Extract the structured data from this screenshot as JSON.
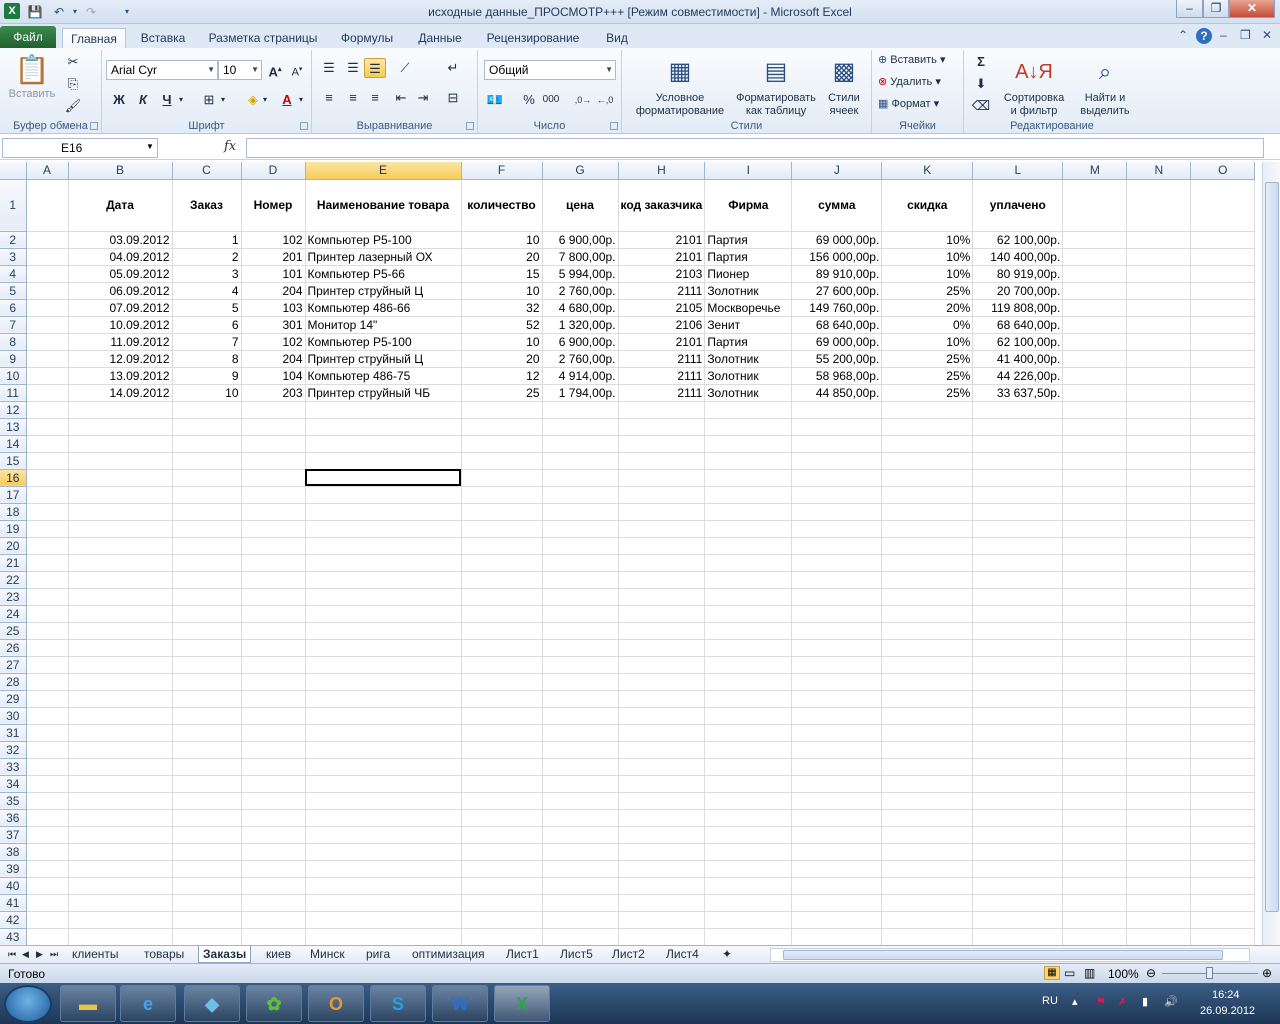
{
  "window": {
    "title": "исходные данные_ПРОСМОТР+++  [Режим совместимости]  -  Microsoft Excel"
  },
  "ribbon_tabs": [
    "Файл",
    "Главная",
    "Вставка",
    "Разметка страницы",
    "Формулы",
    "Данные",
    "Рецензирование",
    "Вид"
  ],
  "ribbon": {
    "clipboard": {
      "label": "Буфер обмена",
      "paste": "Вставить"
    },
    "font": {
      "label": "Шрифт",
      "name": "Arial Cyr",
      "size": "10",
      "bold": "Ж",
      "italic": "К",
      "underline": "Ч"
    },
    "alignment": {
      "label": "Выравнивание"
    },
    "number": {
      "label": "Число",
      "format": "Общий"
    },
    "styles": {
      "label": "Стили",
      "conditional": "Условное форматирование",
      "as_table": "Форматировать как таблицу",
      "cell_styles": "Стили ячеек"
    },
    "cells": {
      "label": "Ячейки",
      "insert": "Вставить",
      "delete": "Удалить",
      "format": "Формат"
    },
    "editing": {
      "label": "Редактирование",
      "sort": "Сортировка и фильтр",
      "find": "Найти и выделить"
    }
  },
  "formula_bar": {
    "name_box": "E16",
    "fx": "fx",
    "value": ""
  },
  "columns": [
    "A",
    "B",
    "C",
    "D",
    "E",
    "F",
    "G",
    "H",
    "I",
    "J",
    "K",
    "L",
    "M",
    "N",
    "O"
  ],
  "headers": [
    "Дата",
    "Заказ",
    "Номер",
    "Наименование товара",
    "количество",
    "цена",
    "код заказчика",
    "Фирма",
    "сумма",
    "скидка",
    "уплачено"
  ],
  "rows": [
    [
      "03.09.2012",
      "1",
      "102",
      "Компьютер Р5-100",
      "10",
      "6 900,00р.",
      "2101",
      "Партия",
      "69 000,00р.",
      "10%",
      "62 100,00р."
    ],
    [
      "04.09.2012",
      "2",
      "201",
      "Принтер лазерный ОХ",
      "20",
      "7 800,00р.",
      "2101",
      "Партия",
      "156 000,00р.",
      "10%",
      "140 400,00р."
    ],
    [
      "05.09.2012",
      "3",
      "101",
      "Компьютер Р5-66",
      "15",
      "5 994,00р.",
      "2103",
      "Пионер",
      "89 910,00р.",
      "10%",
      "80 919,00р."
    ],
    [
      "06.09.2012",
      "4",
      "204",
      "Принтер струйный Ц",
      "10",
      "2 760,00р.",
      "2111",
      "Золотник",
      "27 600,00р.",
      "25%",
      "20 700,00р."
    ],
    [
      "07.09.2012",
      "5",
      "103",
      "Компьютер 486-66",
      "32",
      "4 680,00р.",
      "2105",
      "Москворечье",
      "149 760,00р.",
      "20%",
      "119 808,00р."
    ],
    [
      "10.09.2012",
      "6",
      "301",
      "Монитор 14\"",
      "52",
      "1 320,00р.",
      "2106",
      "Зенит",
      "68 640,00р.",
      "0%",
      "68 640,00р."
    ],
    [
      "11.09.2012",
      "7",
      "102",
      "Компьютер Р5-100",
      "10",
      "6 900,00р.",
      "2101",
      "Партия",
      "69 000,00р.",
      "10%",
      "62 100,00р."
    ],
    [
      "12.09.2012",
      "8",
      "204",
      "Принтер струйный Ц",
      "20",
      "2 760,00р.",
      "2111",
      "Золотник",
      "55 200,00р.",
      "25%",
      "41 400,00р."
    ],
    [
      "13.09.2012",
      "9",
      "104",
      "Компьютер 486-75",
      "12",
      "4 914,00р.",
      "2111",
      "Золотник",
      "58 968,00р.",
      "25%",
      "44 226,00р."
    ],
    [
      "14.09.2012",
      "10",
      "203",
      "Принтер струйный ЧБ",
      "25",
      "1 794,00р.",
      "2111",
      "Золотник",
      "44 850,00р.",
      "25%",
      "33 637,50р."
    ]
  ],
  "sheet_tabs": [
    "клиенты",
    "товары",
    "Заказы",
    "киев",
    "Минск",
    "рига",
    "оптимизация",
    "Лист1",
    "Лист5",
    "Лист2",
    "Лист4"
  ],
  "active_sheet": "Заказы",
  "status": {
    "ready": "Готово",
    "zoom": "100%"
  },
  "taskbar": {
    "lang": "RU",
    "time": "16:24",
    "date": "26.09.2012"
  }
}
